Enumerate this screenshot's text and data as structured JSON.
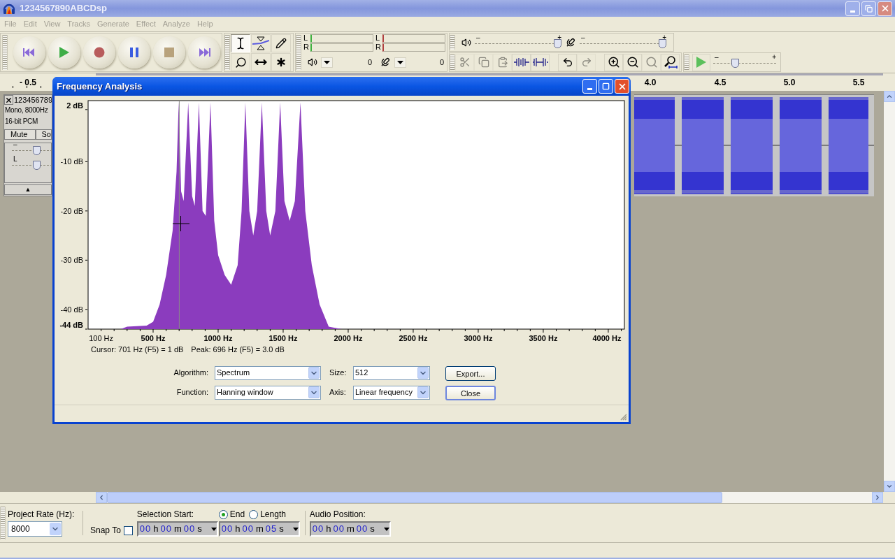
{
  "window": {
    "title": "1234567890ABCDsp"
  },
  "menu": [
    {
      "label": "File",
      "disabled": true
    },
    {
      "label": "Edit",
      "disabled": true
    },
    {
      "label": "View",
      "disabled": true
    },
    {
      "label": "Tracks",
      "disabled": true
    },
    {
      "label": "Generate",
      "disabled": true
    },
    {
      "label": "Effect",
      "disabled": true
    },
    {
      "label": "Analyze",
      "disabled": true
    },
    {
      "label": "Help",
      "disabled": true
    }
  ],
  "tools": [
    {
      "kind": "select",
      "selected": true
    },
    {
      "kind": "envelope",
      "selected": false
    },
    {
      "kind": "draw",
      "selected": false
    },
    {
      "kind": "zoom",
      "selected": false
    },
    {
      "kind": "time-shift",
      "selected": false
    },
    {
      "kind": "multi",
      "selected": false
    }
  ],
  "meters": [
    {
      "channels": [
        "L",
        "R"
      ],
      "reading": "0"
    },
    {
      "channels": [
        "L",
        "R"
      ],
      "reading": "0"
    }
  ],
  "mixer": [
    {
      "kind": "playback",
      "min": "–",
      "max": "+",
      "level": 1
    },
    {
      "kind": "record",
      "min": "–",
      "max": "+",
      "level": 1
    }
  ],
  "edit_tools": [
    {
      "kind": "cut",
      "disabled": true
    },
    {
      "kind": "copy",
      "disabled": true
    },
    {
      "kind": "paste",
      "disabled": true
    },
    {
      "kind": "trim",
      "disabled": false
    },
    {
      "kind": "silence",
      "disabled": false
    },
    {
      "kind": "undo",
      "disabled": false
    },
    {
      "kind": "redo",
      "disabled": true
    },
    {
      "kind": "zoom-in",
      "disabled": false
    },
    {
      "kind": "zoom-out",
      "disabled": false
    },
    {
      "kind": "zoom-selection",
      "disabled": true
    },
    {
      "kind": "zoom-fit",
      "disabled": false
    }
  ],
  "play_at_speed": {
    "min": "–",
    "max": "+",
    "level": 0.33
  },
  "ruler": {
    "labels": [
      "- 0.5",
      "4.0",
      "4.5",
      "5.0",
      "5.5"
    ]
  },
  "track": {
    "name": "123456789",
    "info": [
      "Mono, 8000Hz",
      "16-bit PCM"
    ],
    "buttons": [
      "Mute",
      "So"
    ],
    "gain": {
      "label": "–",
      "level": 0.63
    },
    "pan": {
      "label": "L",
      "level": 0.63
    },
    "collapse": "▲"
  },
  "dialog": {
    "title": "Frequency Analysis",
    "chart_data": {
      "type": "area",
      "x": [
        0,
        250,
        300,
        450,
        500,
        550,
        600,
        650,
        680,
        697,
        715,
        735,
        770,
        800,
        820,
        852,
        880,
        905,
        941,
        970,
        1000,
        1050,
        1100,
        1150,
        1180,
        1209,
        1240,
        1270,
        1300,
        1336,
        1370,
        1400,
        1440,
        1477,
        1510,
        1550,
        1590,
        1633,
        1670,
        1720,
        1780,
        1850,
        1950,
        4124
      ],
      "series": [
        {
          "color": "#8b3cbe",
          "values": [
            -44,
            -44,
            -43.5,
            -43.3,
            -42.5,
            -39,
            -33,
            -24,
            -12,
            2,
            -16,
            -18,
            2,
            -17,
            -19,
            2,
            -20,
            -21,
            2,
            -22,
            -29,
            -33,
            -35,
            -31,
            -20,
            2,
            -20,
            -25,
            -20,
            2,
            -20,
            -25,
            -20,
            2,
            -18,
            -22,
            -18,
            2,
            -20,
            -31,
            -39,
            -43.5,
            -44,
            -44
          ]
        }
      ],
      "xlim": [
        0,
        4124
      ],
      "ylim": [
        -44,
        2.4
      ],
      "xticks": [
        {
          "value": 100,
          "label": "100 Hz"
        },
        {
          "value": 500,
          "label": "500 Hz"
        },
        {
          "value": 1000,
          "label": "1000 Hz"
        },
        {
          "value": 1500,
          "label": "1500 Hz"
        },
        {
          "value": 2000,
          "label": "2000 Hz"
        },
        {
          "value": 2500,
          "label": "2500 Hz"
        },
        {
          "value": 3000,
          "label": "3000 Hz"
        },
        {
          "value": 3500,
          "label": "3500 Hz"
        },
        {
          "value": 4000,
          "label": "4000 Hz"
        }
      ],
      "yticks": [
        {
          "value": 2,
          "label": "2 dB"
        },
        {
          "value": -10,
          "label": "-10 dB"
        },
        {
          "value": -20,
          "label": "-20 dB"
        },
        {
          "value": -30,
          "label": "-30 dB"
        },
        {
          "value": -40,
          "label": "-40 dB"
        },
        {
          "value": -44,
          "label": "-44 dB"
        }
      ],
      "ref_lines": [
        {
          "axis": "x",
          "value": 701
        }
      ]
    },
    "cursor_text": "Cursor: 701 Hz (F5) = 1 dB",
    "peak_text": "Peak: 696 Hz (F5) = 3.0 dB",
    "fields": [
      {
        "label": "Algorithm:",
        "value": "Spectrum"
      },
      {
        "label": "Size:",
        "value": "512"
      },
      {
        "label": "Function:",
        "value": "Hanning window"
      },
      {
        "label": "Axis:",
        "value": "Linear frequency"
      }
    ],
    "buttons": [
      {
        "label": "Export...",
        "default": false
      },
      {
        "label": "Close",
        "default": true
      }
    ]
  },
  "selection_bar": {
    "project_rate": {
      "label": "Project Rate (Hz):",
      "value": "8000"
    },
    "snap_to": {
      "label": "Snap To",
      "checked": false
    },
    "selection_start": {
      "label": "Selection Start:",
      "time": [
        {
          "digits": "00",
          "unit": "h"
        },
        {
          "digits": "00",
          "unit": "m"
        },
        {
          "digits": "00",
          "unit": "s"
        }
      ]
    },
    "end_mode": [
      {
        "label": "End",
        "selected": true
      },
      {
        "label": "Length",
        "selected": false
      }
    ],
    "end_time": [
      {
        "digits": "00",
        "unit": "h"
      },
      {
        "digits": "00",
        "unit": "m"
      },
      {
        "digits": "05",
        "unit": "s"
      }
    ],
    "audio_position": {
      "label": "Audio Position:",
      "time": [
        {
          "digits": "00",
          "unit": "h"
        },
        {
          "digits": "00",
          "unit": "m"
        },
        {
          "digits": "00",
          "unit": "s"
        }
      ]
    }
  }
}
